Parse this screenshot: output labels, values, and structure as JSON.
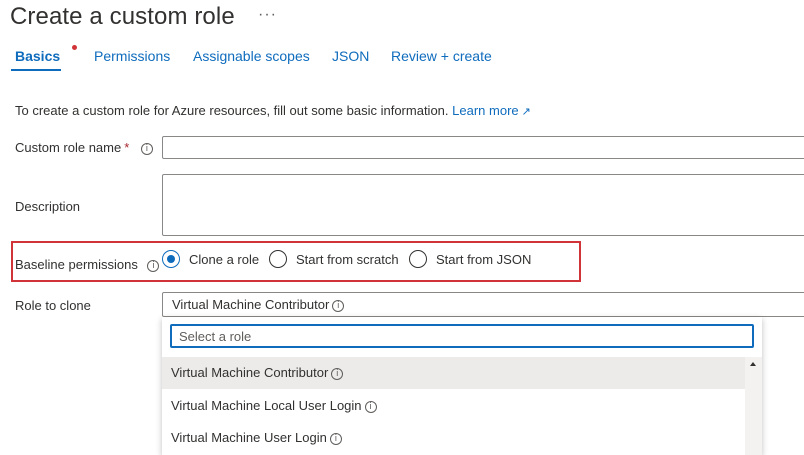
{
  "page": {
    "title": "Create a custom role",
    "more_label": "···"
  },
  "tabs": [
    {
      "label": "Basics",
      "active": true
    },
    {
      "label": "Permissions"
    },
    {
      "label": "Assignable scopes"
    },
    {
      "label": "JSON"
    },
    {
      "label": "Review + create"
    }
  ],
  "intro": {
    "text": "To create a custom role for Azure resources, fill out some basic information.",
    "link": "Learn more"
  },
  "form": {
    "custom_role_name_label": "Custom role name",
    "required_mark": "*",
    "custom_role_name_value": "",
    "description_label": "Description",
    "description_value": "",
    "baseline_label": "Baseline permissions",
    "baseline_options": [
      "Clone a role",
      "Start from scratch",
      "Start from JSON"
    ],
    "baseline_selected": "Clone a role",
    "role_to_clone_label": "Role to clone",
    "role_to_clone_value": "Virtual Machine Contributor"
  },
  "dropdown": {
    "search_placeholder": "Select a role",
    "options": [
      "Virtual Machine Contributor",
      "Virtual Machine Local User Login",
      "Virtual Machine User Login"
    ]
  },
  "icons": {
    "info": "info-circle-icon",
    "external": "external-link-icon"
  },
  "colors": {
    "accent": "#0f6cbd",
    "highlight_border": "#d13438",
    "required": "#a4262c"
  }
}
